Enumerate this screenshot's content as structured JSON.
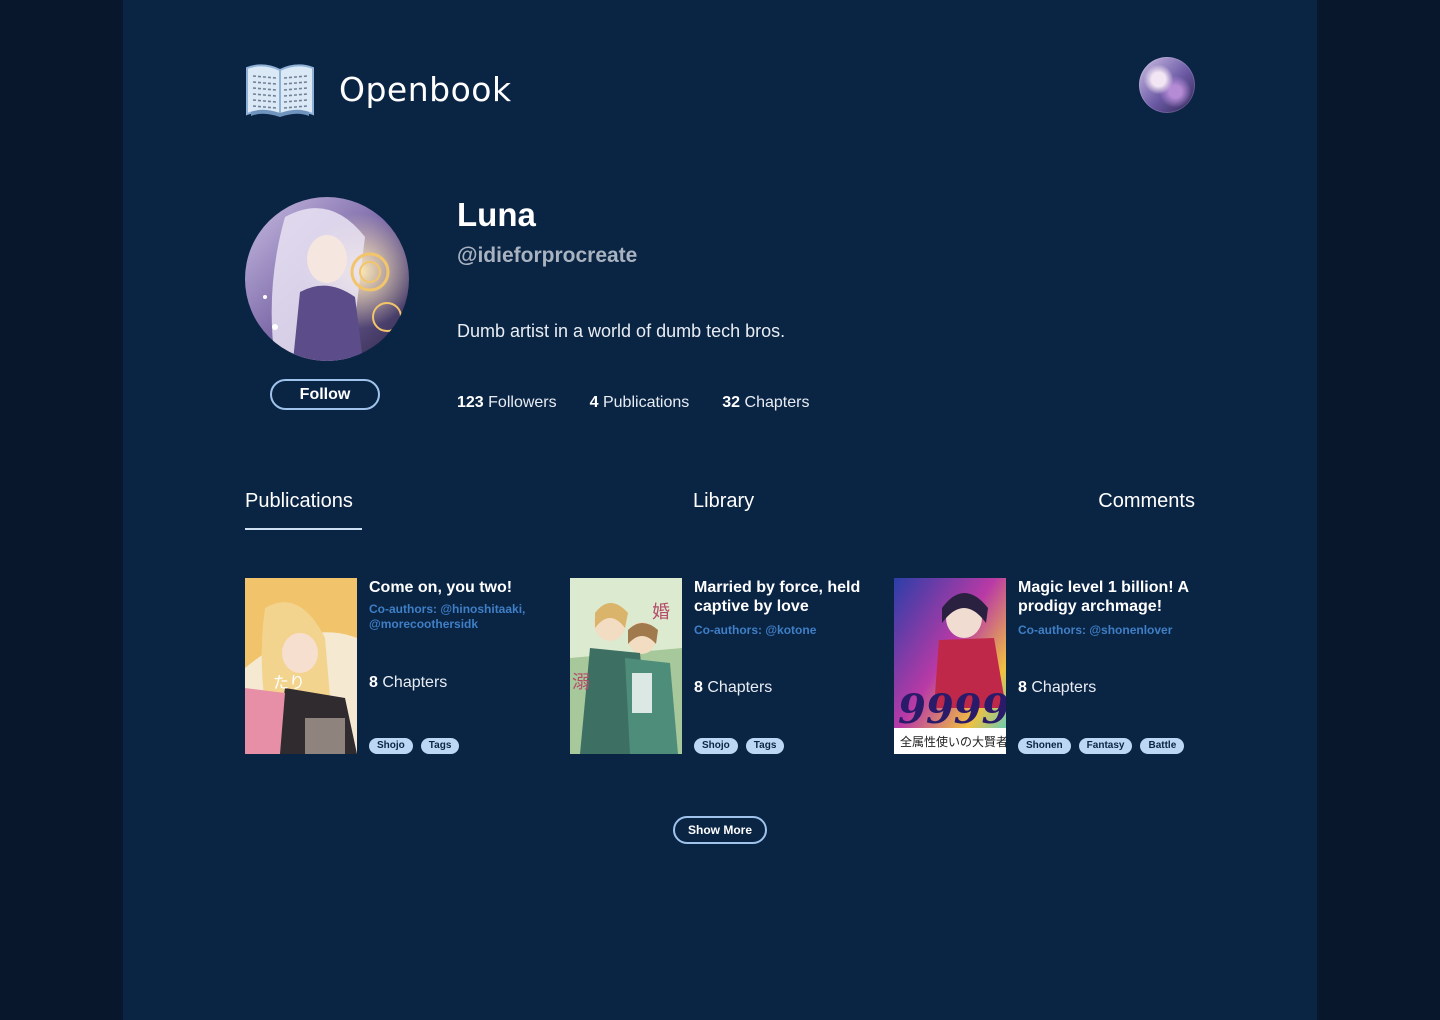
{
  "app": {
    "name": "Openbook",
    "logo_icon": "open-book-icon"
  },
  "header": {
    "avatar_icon": "user-avatar"
  },
  "profile": {
    "name": "Luna",
    "handle": "@idieforprocreate",
    "bio": "Dumb artist in a world of dumb tech bros.",
    "follow_label": "Follow",
    "stats": [
      {
        "count": "123",
        "label": "Followers"
      },
      {
        "count": "4",
        "label": "Publications"
      },
      {
        "count": "32",
        "label": "Chapters"
      }
    ]
  },
  "tabs": {
    "items": [
      "Publications",
      "Library",
      "Comments"
    ],
    "active": "Publications"
  },
  "publications": [
    {
      "title": "Come on, you two!",
      "coauthors": "Co-authors: @hinoshitaaki, @morecoothersidk",
      "chapters_count": "8",
      "chapters_label": "Chapters",
      "tags": [
        "Shojo",
        "Tags"
      ]
    },
    {
      "title": "Married by force, held captive by love",
      "coauthors": "Co-authors: @kotone",
      "chapters_count": "8",
      "chapters_label": "Chapters",
      "tags": [
        "Shojo",
        "Tags"
      ]
    },
    {
      "title": "Magic level 1 billion! A prodigy archmage!",
      "coauthors": "Co-authors: @shonenlover",
      "chapters_count": "8",
      "chapters_label": "Chapters",
      "tags": [
        "Shonen",
        "Fantasy",
        "Battle"
      ],
      "cover_text": "9999"
    }
  ],
  "show_more_label": "Show More",
  "colors": {
    "background": "#08172b",
    "panel": "#0a2444",
    "accent_border": "#9fc3ea",
    "coauthor_link": "#3f7fc6",
    "tag_bg": "#bcd7f3"
  }
}
